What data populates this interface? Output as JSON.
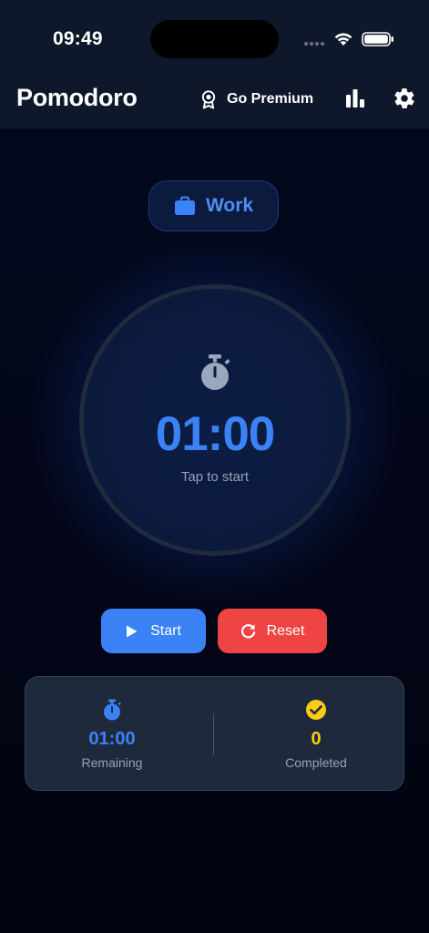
{
  "status_bar": {
    "time": "09:49"
  },
  "header": {
    "title": "Pomodoro",
    "premium_label": "Go Premium",
    "icons": [
      "award-icon",
      "bar-chart-icon",
      "gear-icon"
    ]
  },
  "mode": {
    "label": "Work",
    "icon": "briefcase-icon"
  },
  "timer": {
    "display": "01:00",
    "hint": "Tap to start",
    "icon": "stopwatch-icon"
  },
  "controls": {
    "start_label": "Start",
    "reset_label": "Reset"
  },
  "stats": {
    "remaining_value": "01:00",
    "remaining_label": "Remaining",
    "completed_value": "0",
    "completed_label": "Completed"
  },
  "colors": {
    "accent_blue": "#3b82f6",
    "reset_red": "#ef4444",
    "completed_yellow": "#facc15",
    "background": "#020617",
    "card": "#1e293b"
  }
}
